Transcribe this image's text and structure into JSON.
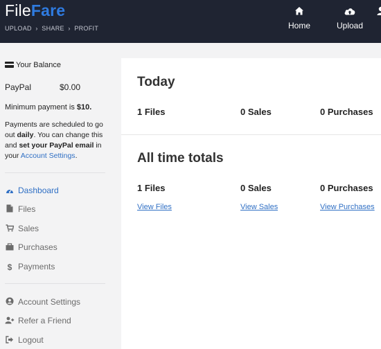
{
  "header": {
    "logo_part1": "File",
    "logo_part2": "Fare",
    "breadcrumb": "UPLOAD  ›  SHARE  ›  PROFIT",
    "nav": [
      {
        "label": "Home",
        "icon": "home-icon"
      },
      {
        "label": "Upload",
        "icon": "cloud-upload-icon"
      }
    ]
  },
  "sidebar": {
    "balance_title": "Your Balance",
    "paypal_label": "PayPal",
    "paypal_value": "$0.00",
    "min_payment_prefix": "Minimum payment is ",
    "min_payment_value": "$10.",
    "sched_1": "Payments are scheduled to go out ",
    "sched_daily": "daily",
    "sched_2": ". You can change this and ",
    "sched_bold": "set your PayPal email",
    "sched_3": " in your ",
    "sched_link": "Account Settings",
    "sched_4": ".",
    "menu": [
      {
        "label": "Dashboard",
        "icon": "dashboard-icon"
      },
      {
        "label": "Files",
        "icon": "file-icon"
      },
      {
        "label": "Sales",
        "icon": "cart-icon"
      },
      {
        "label": "Purchases",
        "icon": "bag-icon"
      },
      {
        "label": "Payments",
        "icon": "dollar-icon"
      }
    ],
    "menu2": [
      {
        "label": "Account Settings",
        "icon": "user-circle-icon"
      },
      {
        "label": "Refer a Friend",
        "icon": "user-plus-icon"
      },
      {
        "label": "Logout",
        "icon": "sign-out-icon"
      }
    ]
  },
  "main": {
    "today_title": "Today",
    "today_files": "1 Files",
    "today_sales": "0 Sales",
    "today_purchases": "0 Purchases",
    "totals_title": "All time totals",
    "totals_files": "1 Files",
    "totals_sales": "0 Sales",
    "totals_purchases": "0 Purchases",
    "view_files": "View Files",
    "view_sales": "View Sales",
    "view_purchases": "View Purchases"
  },
  "colors": {
    "header_bg": "#1f2432",
    "accent": "#2f7be0",
    "link": "#2f6fc4"
  }
}
